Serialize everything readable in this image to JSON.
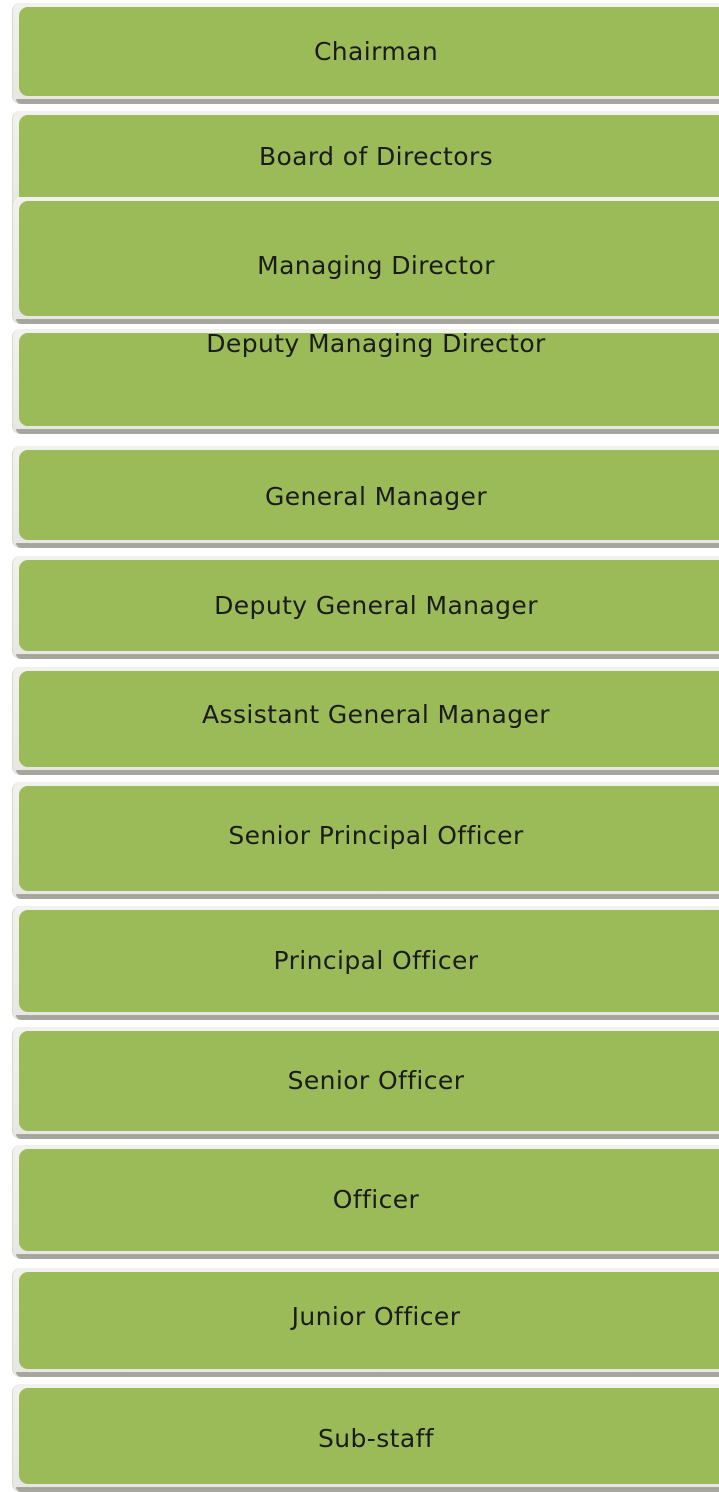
{
  "hierarchy": {
    "levels": [
      {
        "label": "Chairman"
      },
      {
        "label": "Board of Directors"
      },
      {
        "label": "Managing Director"
      },
      {
        "label": "Deputy Managing Director"
      },
      {
        "label": "General Manager"
      },
      {
        "label": "Deputy General Manager"
      },
      {
        "label": "Assistant General Manager"
      },
      {
        "label": "Senior Principal Officer"
      },
      {
        "label": "Principal Officer"
      },
      {
        "label": "Senior Officer"
      },
      {
        "label": "Officer"
      },
      {
        "label": "Junior Officer"
      },
      {
        "label": "Sub-staff"
      }
    ],
    "colors": {
      "box_fill": "#9bbb59",
      "plate": "#e9e9e5",
      "text": "#1b1b1b"
    }
  }
}
